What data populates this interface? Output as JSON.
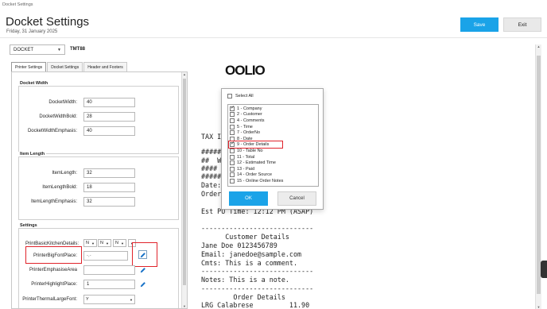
{
  "window": {
    "title": "Docket Settings"
  },
  "header": {
    "title": "Docket Settings",
    "date": "Friday, 31 January 2025",
    "save_label": "Save",
    "exit_label": "Exit"
  },
  "docket_select": {
    "value": "DOCKET",
    "printer": "TMT88"
  },
  "tabs": [
    {
      "label": "Printer Settings",
      "active": true
    },
    {
      "label": "Docket Settings",
      "active": false
    },
    {
      "label": "Header and Footers",
      "active": false
    }
  ],
  "docket_width": {
    "title": "Docket Width",
    "rows": [
      {
        "label": "DocketWidth:",
        "value": "40"
      },
      {
        "label": "DocketWidthBold:",
        "value": "28"
      },
      {
        "label": "DocketWidthEmphasis:",
        "value": "40"
      }
    ]
  },
  "item_length": {
    "title": "Item Length",
    "rows": [
      {
        "label": "ItemLength:",
        "value": "32"
      },
      {
        "label": "ItemLengthBold:",
        "value": "18"
      },
      {
        "label": "ItemLengthEmphasis:",
        "value": "32"
      }
    ]
  },
  "settings": {
    "title": "Settings",
    "basic_kitchen": {
      "label": "PrintBasicKitchenDetails:",
      "values": [
        "N",
        "N",
        "N"
      ]
    },
    "big_font": {
      "label": "PrinterBigFontPlace:",
      "value": "-,-"
    },
    "emphasise": {
      "label": "PrinterEmphasiseArea",
      "value": ""
    },
    "highlight": {
      "label": "PrinterHighlightPlace:",
      "value": "1"
    },
    "thermal": {
      "label": "PrinterThermalLargeFont:",
      "value": "Y"
    }
  },
  "preview": {
    "logo": "OOLIO",
    "lines": [
      "TAX IN",
      "######",
      "##  W",
      "####",
      "######",
      "Date:",
      "Order:",
      "",
      "Est PU Time: 12:12 PM (ASAP)",
      "----------------------------",
      "      Customer Details",
      "Jane Doe 0123456789",
      "Email: janedoe@sample.com",
      "Cmts: This is a comment.",
      "----------------------------",
      "Notes: This is a note.",
      "----------------------------",
      "        Order Details",
      "LRG Calabrese         11.90"
    ]
  },
  "popup": {
    "select_all": "Select All",
    "items": [
      {
        "label": "1 - Company",
        "checked": true
      },
      {
        "label": "2 - Customer",
        "checked": false
      },
      {
        "label": "4 - Comments",
        "checked": false
      },
      {
        "label": "5 - Time",
        "checked": false
      },
      {
        "label": "7 - OrderNo",
        "checked": false
      },
      {
        "label": "8 - Date",
        "checked": false
      },
      {
        "label": "9 - Order Details",
        "checked": true
      },
      {
        "label": "10 - Table No",
        "checked": false
      },
      {
        "label": "11 - Total",
        "checked": false
      },
      {
        "label": "12 - Estimated Time",
        "checked": false
      },
      {
        "label": "13 - Paid",
        "checked": false
      },
      {
        "label": "14 - Order Source",
        "checked": false
      },
      {
        "label": "15 - Online Order Notes",
        "checked": false
      }
    ],
    "ok_label": "OK",
    "cancel_label": "Cancel"
  },
  "colors": {
    "accent": "#1aa3e8",
    "highlight": "#e0232b",
    "icon": "#1a73c8"
  },
  "icons": {
    "edit": "pencil-icon",
    "dropdown": "chevron-down-icon"
  }
}
